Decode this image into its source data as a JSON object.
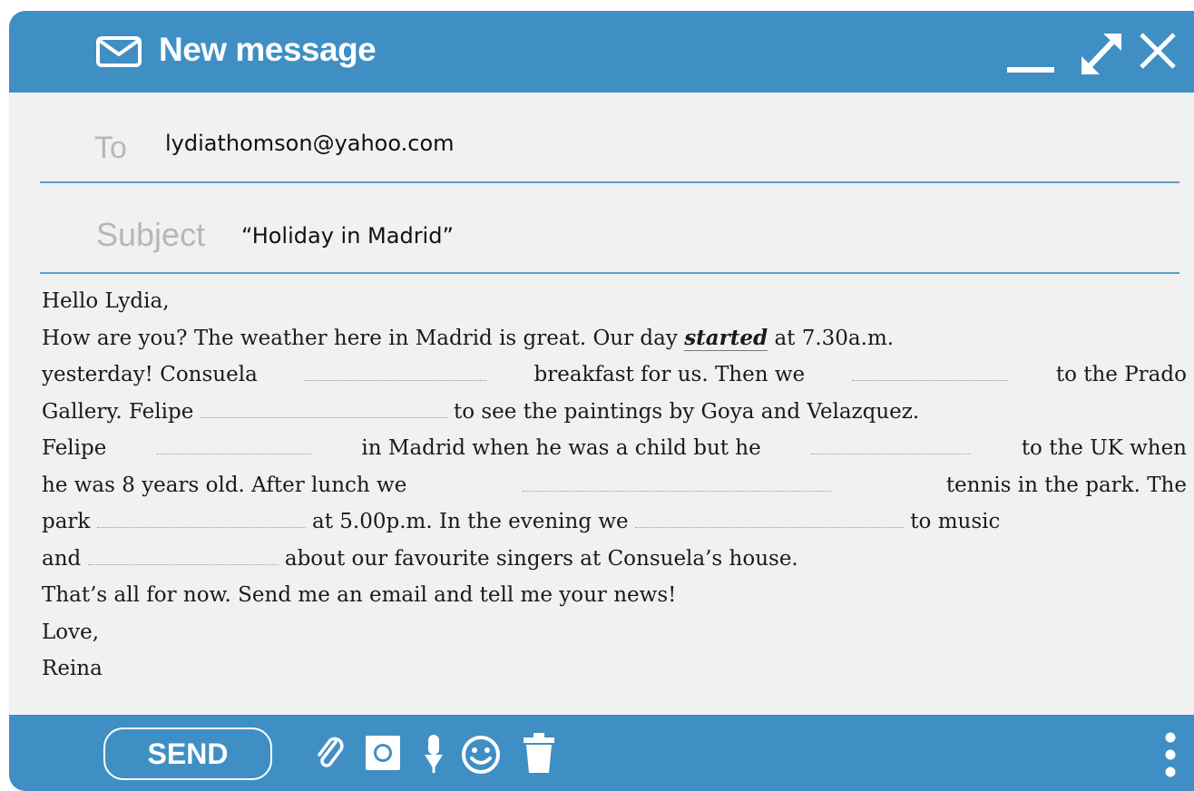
{
  "window": {
    "title": "New message",
    "accent_color": "#3f8fc4",
    "title_icon": "envelope-icon",
    "controls": [
      "minimize-icon",
      "maximize-icon",
      "close-icon"
    ]
  },
  "to": {
    "label": "To",
    "value": "lydiathomson@yahoo.com"
  },
  "subject": {
    "label": "Subject",
    "value": "“Holiday in Madrid”"
  },
  "message": {
    "greeting": "Hello Lydia,",
    "line1_a": "How are you? The weather here in Madrid is great. Our day",
    "example_answer": "started",
    "line1_b": "at 7.30a.m.",
    "line2_a": "yesterday! Consuela",
    "line2_b": "breakfast for us. Then we",
    "line2_c": "to the Prado",
    "line3_a": "Gallery. Felipe",
    "line3_b": "to see the paintings by Goya and Velazquez.",
    "line4_a": "Felipe",
    "line4_b": "in Madrid when he was a child but he",
    "line4_c": "to the UK when",
    "line5_a": "he was 8 years old. After lunch we",
    "line5_b": "tennis in the park. The",
    "line6_a": "park",
    "line6_b": "at 5.00p.m. In the evening we",
    "line6_c": "to music",
    "line7_a": "and",
    "line7_b": "about our favourite singers at Consuela’s house.",
    "line8": "That’s all for now. Send me an email and tell me your news!",
    "closing": "Love,",
    "signature": "Reina"
  },
  "toolbar": {
    "send_label": "SEND",
    "icons": [
      "paperclip-icon",
      "camera-icon",
      "microphone-icon",
      "emoji-icon",
      "trash-icon",
      "more-vertical-icon"
    ]
  }
}
